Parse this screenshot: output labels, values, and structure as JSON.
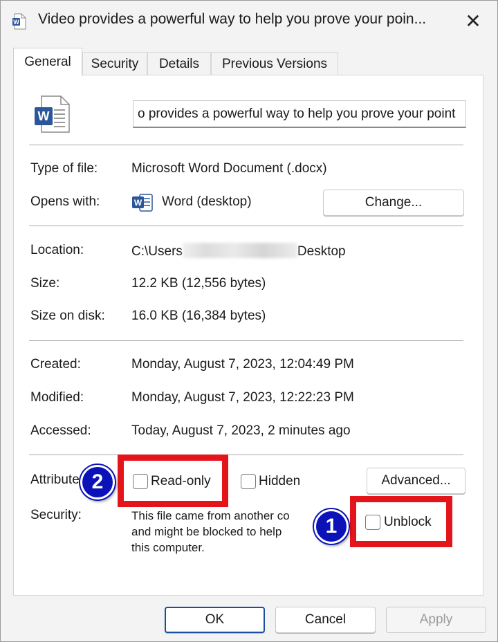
{
  "window": {
    "title": "Video provides a powerful way to help you prove your poin...",
    "close_glyph": "✕"
  },
  "tabs": [
    {
      "label": "General",
      "active": true
    },
    {
      "label": "Security",
      "active": false
    },
    {
      "label": "Details",
      "active": false
    },
    {
      "label": "Previous Versions",
      "active": false
    }
  ],
  "general": {
    "file_name_value": "o provides a powerful way to help you prove your point",
    "type_of_file_label": "Type of file:",
    "type_of_file_value": "Microsoft Word Document (.docx)",
    "opens_with_label": "Opens with:",
    "opens_with_value": "Word (desktop)",
    "change_button": "Change...",
    "location_label": "Location:",
    "location_prefix": "C:\\Users",
    "location_suffix": "Desktop",
    "size_label": "Size:",
    "size_value": "12.2 KB (12,556 bytes)",
    "size_on_disk_label": "Size on disk:",
    "size_on_disk_value": "16.0 KB (16,384 bytes)",
    "created_label": "Created:",
    "created_value": "Monday, August 7, 2023, 12:04:49 PM",
    "modified_label": "Modified:",
    "modified_value": "Monday, August 7, 2023, 12:22:23 PM",
    "accessed_label": "Accessed:",
    "accessed_value": "Today, August 7, 2023, 2 minutes ago",
    "attributes_label": "Attribute",
    "read_only_label": "Read-only",
    "hidden_label": "Hidden",
    "advanced_button": "Advanced...",
    "security_label": "Security:",
    "security_line1": "This file came from another co",
    "security_line2": "and might be blocked to help",
    "security_line3": "this computer.",
    "unblock_label": "Unblock"
  },
  "annotations": {
    "badge_1": "1",
    "badge_2": "2",
    "highlight_color": "#e4141b",
    "badge_color": "#0b12b8"
  },
  "footer": {
    "ok_button": "OK",
    "cancel_button": "Cancel",
    "apply_button": "Apply"
  },
  "icons": {
    "word_document": "word-document-icon",
    "word_app": "word-app-icon",
    "close": "close-icon"
  },
  "colors": {
    "word_blue": "#2b579a",
    "window_bg": "#f3f3f3"
  }
}
